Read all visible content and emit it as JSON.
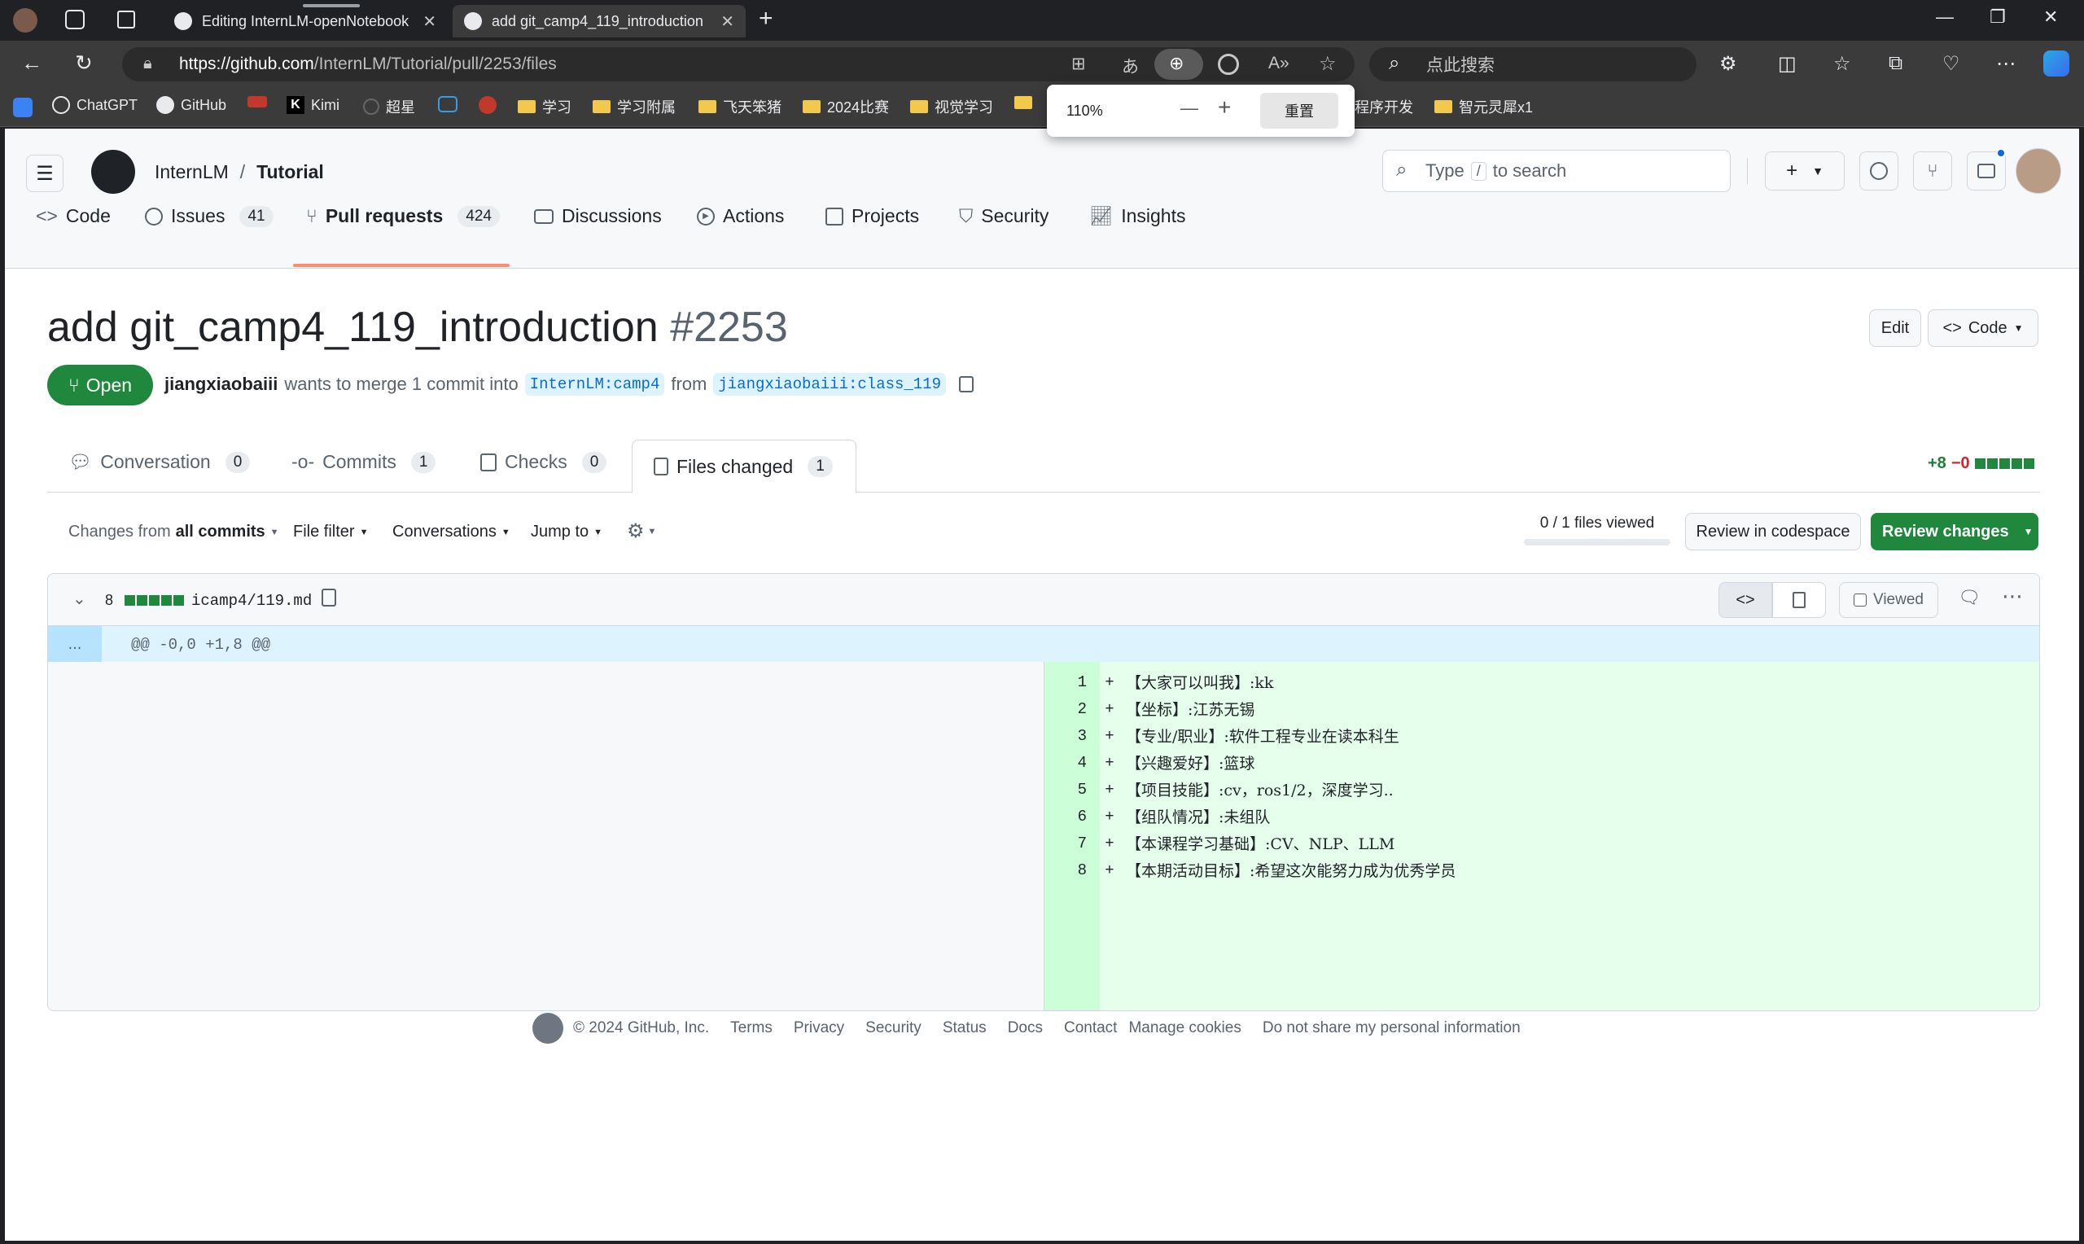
{
  "browser": {
    "tabs": [
      {
        "title": "Editing InternLM-openNotebook",
        "active": false
      },
      {
        "title": "add git_camp4_119_introduction",
        "active": true
      }
    ],
    "url": {
      "host": "https://github.com",
      "path": "/InternLM/Tutorial/pull/2253/files"
    },
    "search_placeholder": "点此搜索",
    "bookmarks": [
      "ChatGPT",
      "GitHub",
      "Kimi",
      "超星",
      "学习",
      "学习附属",
      "飞天笨猪",
      "2024比赛",
      "视觉学习",
      "程序开发",
      "智元灵犀x1"
    ],
    "zoom_popup": {
      "level": "110%",
      "minus": "—",
      "plus": "+",
      "reset_label": "重置"
    }
  },
  "header": {
    "owner": "InternLM",
    "separator": "/",
    "repo": "Tutorial",
    "search_prefix": "Type",
    "search_key": "/",
    "search_suffix": "to search"
  },
  "repo_nav": [
    {
      "label": "Code",
      "icon": "code-icon"
    },
    {
      "label": "Issues",
      "count": "41",
      "icon": "issue-icon"
    },
    {
      "label": "Pull requests",
      "count": "424",
      "icon": "pull-request-icon",
      "selected": true
    },
    {
      "label": "Discussions",
      "icon": "discussion-icon"
    },
    {
      "label": "Actions",
      "icon": "play-icon"
    },
    {
      "label": "Projects",
      "icon": "table-icon"
    },
    {
      "label": "Security",
      "icon": "shield-icon"
    },
    {
      "label": "Insights",
      "icon": "graph-icon"
    }
  ],
  "pr": {
    "title": "add git_camp4_119_introduction",
    "number": "#2253",
    "status": "Open",
    "author": "jiangxiaobaiii",
    "merge_text": "wants to merge 1 commit into",
    "base_branch": "InternLM:camp4",
    "from_text": "from",
    "head_branch": "jiangxiaobaiii:class_119",
    "edit_label": "Edit",
    "code_label": "Code"
  },
  "pr_tabs": [
    {
      "label": "Conversation",
      "count": "0"
    },
    {
      "label": "Commits",
      "count": "1"
    },
    {
      "label": "Checks",
      "count": "0"
    },
    {
      "label": "Files changed",
      "count": "1",
      "selected": true
    }
  ],
  "diffstat": {
    "added": "+8",
    "removed": "−0"
  },
  "toolbar": {
    "changes_from_prefix": "Changes from",
    "changes_from_value": "all commits",
    "file_filter": "File filter",
    "conversations": "Conversations",
    "jump_to": "Jump to",
    "files_viewed": "0 / 1 files viewed",
    "files_viewed_fraction": 0,
    "review_codespace": "Review in codespace",
    "review_changes": "Review changes"
  },
  "file": {
    "change_count": "8",
    "path": "icamp4/119.md",
    "viewed_label": "Viewed",
    "hunk_expand": "...",
    "hunk_header": "@@ -0,0 +1,8 @@",
    "lines": [
      {
        "num": "1",
        "text": "【大家可以叫我】:kk"
      },
      {
        "num": "2",
        "text": "【坐标】:江苏无锡"
      },
      {
        "num": "3",
        "text": "【专业/职业】:软件工程专业在读本科生"
      },
      {
        "num": "4",
        "text": "【兴趣爱好】:篮球"
      },
      {
        "num": "5",
        "text": "【项目技能】:cv，ros1/2，深度学习.."
      },
      {
        "num": "6",
        "text": "【组队情况】:未组队"
      },
      {
        "num": "7",
        "text": "【本课程学习基础】:CV、NLP、LLM"
      },
      {
        "num": "8",
        "text": "【本期活动目标】:希望这次能努力成为优秀学员"
      }
    ]
  },
  "footer": {
    "copyright": "© 2024 GitHub, Inc.",
    "links": [
      "Terms",
      "Privacy",
      "Security",
      "Status",
      "Docs",
      "Contact",
      "Manage cookies",
      "Do not share my personal information"
    ]
  },
  "colors": {
    "accent_green": "#1f883d",
    "addition_bg": "#dafbe1",
    "hunk_bg": "#ddf4ff",
    "link_blue": "#0969da",
    "nav_underline": "#fd8c73"
  }
}
